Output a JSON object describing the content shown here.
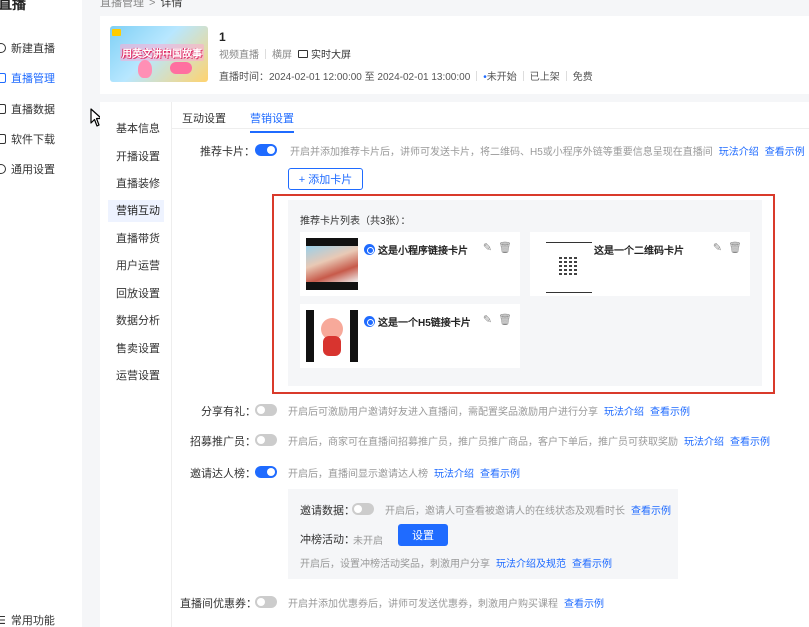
{
  "nav": {
    "brand": "直播",
    "items": [
      "新建直播",
      "直播管理",
      "直播数据",
      "软件下载",
      "通用设置"
    ],
    "active_index": 1,
    "bottom": "常用功能"
  },
  "breadcrumb": [
    "直播管理",
    "详情"
  ],
  "live": {
    "cover_text": "用英文讲中国故事",
    "title": "1",
    "type": "视频直播",
    "orientation": "横屏",
    "screen": "实时大屏",
    "time_label": "直播时间：",
    "time_value": "2024-02-01 12:00:00 至 2024-02-01 13:00:00",
    "status": "未开始",
    "listed": "已上架",
    "price": "免费"
  },
  "subnav": {
    "items": [
      "基本信息",
      "开播设置",
      "直播装修",
      "营销互动",
      "直播带货",
      "用户运营",
      "回放设置",
      "数据分析",
      "售卖设置",
      "运营设置"
    ],
    "active_index": 3
  },
  "tabs": {
    "items": [
      "互动设置",
      "营销设置"
    ],
    "active_index": 1
  },
  "settings": {
    "rec_card": {
      "label": "推荐卡片：",
      "enabled": true,
      "desc": "开启并添加推荐卡片后，讲师可发送卡片，将二维码、H5或小程序外链等重要信息呈现在直播间",
      "link1": "玩法介绍",
      "link2": "查看示例",
      "add_button": "+ 添加卡片",
      "list_title": "推荐卡片列表（共3张）：",
      "cards": [
        {
          "title": "这是小程序链接卡片"
        },
        {
          "title": "这是一个二维码卡片"
        },
        {
          "title": "这是一个H5链接卡片"
        }
      ]
    },
    "share": {
      "label": "分享有礼：",
      "enabled": false,
      "desc": "开启后可激励用户邀请好友进入直播间，需配置奖品激励用户进行分享",
      "link1": "玩法介绍",
      "link2": "查看示例"
    },
    "promoter": {
      "label": "招募推广员：",
      "enabled": false,
      "desc": "开启后，商家可在直播间招募推广员，推广员推广商品，客户下单后，推广员可获取奖励",
      "link1": "玩法介绍",
      "link2": "查看示例"
    },
    "invite_rank": {
      "label": "邀请达人榜：",
      "enabled": true,
      "desc": "开启后，直播间显示邀请达人榜",
      "link1": "玩法介绍",
      "link2": "查看示例",
      "data_label": "邀请数据：",
      "data_enabled": false,
      "data_desc": "开启后，邀请人可查看被邀请人的在线状态及观看时长",
      "data_link": "查看示例",
      "rush_label": "冲榜活动：",
      "rush_status": "未开启",
      "rush_button": "设置",
      "rush_desc": "开启后，设置冲榜活动奖品，刺激用户分享",
      "rush_link1": "玩法介绍及规范",
      "rush_link2": "查看示例"
    },
    "coupon": {
      "label": "直播间优惠券：",
      "enabled": false,
      "desc": "开启并添加优惠券后，讲师可发送优惠券，刺激用户购买课程",
      "link1": "查看示例"
    }
  },
  "colors": {
    "accent": "#1f6bff",
    "highlight_box": "#d93a2b"
  }
}
